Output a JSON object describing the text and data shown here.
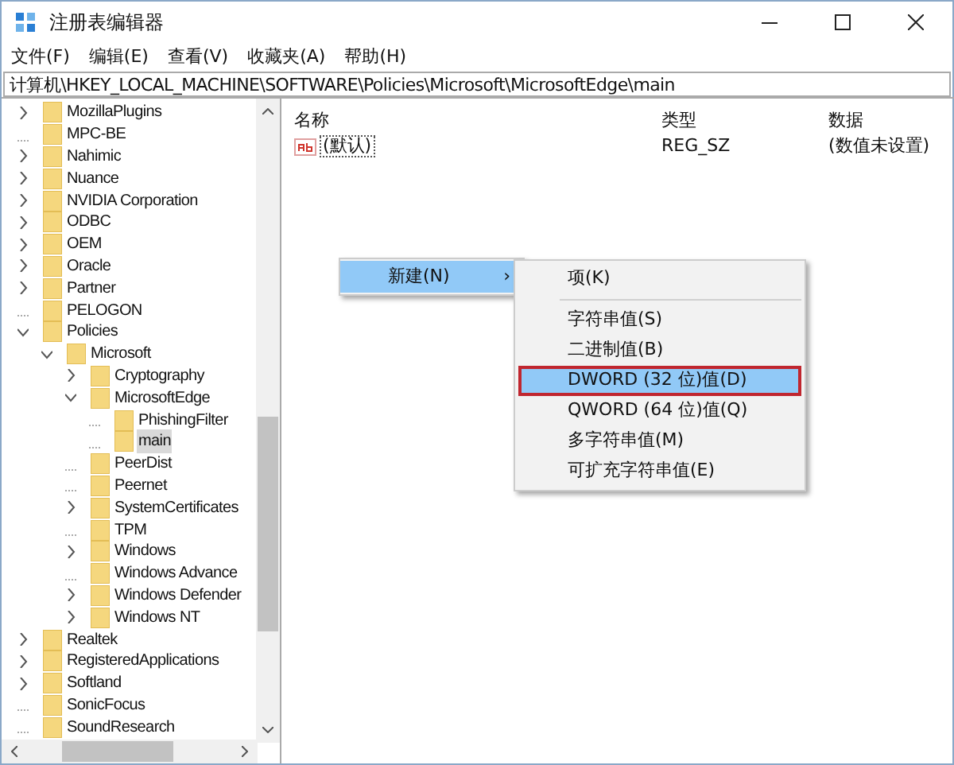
{
  "window": {
    "title": "注册表编辑器"
  },
  "menu_bar": [
    "文件(F)",
    "编辑(E)",
    "查看(V)",
    "收藏夹(A)",
    "帮助(H)"
  ],
  "address_bar": "计算机\\HKEY_LOCAL_MACHINE\\SOFTWARE\\Policies\\Microsoft\\MicrosoftEdge\\main",
  "tree": [
    {
      "label": "MozillaPlugins",
      "expanded": false,
      "selected": false
    },
    {
      "label": "MPC-BE",
      "selected": false
    },
    {
      "label": "Nahimic",
      "expanded": false,
      "selected": false
    },
    {
      "label": "Nuance",
      "expanded": false,
      "selected": false
    },
    {
      "label": "NVIDIA Corporation",
      "expanded": false,
      "selected": false
    },
    {
      "label": "ODBC",
      "expanded": false,
      "selected": false
    },
    {
      "label": "OEM",
      "expanded": false,
      "selected": false
    },
    {
      "label": "Oracle",
      "expanded": false,
      "selected": false
    },
    {
      "label": "Partner",
      "expanded": false,
      "selected": false
    },
    {
      "label": "PELOGON",
      "selected": false
    },
    {
      "label": "Policies",
      "expanded": true,
      "selected": false,
      "children": [
        {
          "label": "Microsoft",
          "expanded": true,
          "selected": false,
          "children": [
            {
              "label": "Cryptography",
              "expanded": false,
              "selected": false
            },
            {
              "label": "MicrosoftEdge",
              "expanded": true,
              "selected": false,
              "children": [
                {
                  "label": "PhishingFilter",
                  "selected": false
                },
                {
                  "label": "main",
                  "selected": true
                }
              ]
            },
            {
              "label": "PeerDist",
              "selected": false
            },
            {
              "label": "Peernet",
              "selected": false
            },
            {
              "label": "SystemCertificates",
              "expanded": false,
              "selected": false
            },
            {
              "label": "TPM",
              "selected": false
            },
            {
              "label": "Windows",
              "expanded": false,
              "selected": false
            },
            {
              "label": "Windows Advance",
              "selected": false
            },
            {
              "label": "Windows Defender",
              "expanded": false,
              "selected": false
            },
            {
              "label": "Windows NT",
              "expanded": false,
              "selected": false
            }
          ]
        }
      ]
    },
    {
      "label": "Realtek",
      "expanded": false,
      "selected": false
    },
    {
      "label": "RegisteredApplications",
      "expanded": false,
      "selected": false
    },
    {
      "label": "Softland",
      "expanded": false,
      "selected": false
    },
    {
      "label": "SonicFocus",
      "selected": false
    },
    {
      "label": "SoundResearch",
      "selected": false
    }
  ],
  "list": {
    "columns": [
      "名称",
      "类型",
      "数据"
    ],
    "rows": [
      {
        "name": "(默认)",
        "type": "REG_SZ",
        "data": "(数值未设置)"
      }
    ]
  },
  "context_menu": {
    "items": [
      {
        "label": "新建(N)",
        "submenu_arrow": "›",
        "selected": true
      }
    ]
  },
  "submenu": {
    "items": [
      {
        "kind": "item",
        "label": "项(K)",
        "selected": false,
        "outlined": false
      },
      {
        "kind": "separator"
      },
      {
        "kind": "item",
        "label": "字符串值(S)",
        "selected": false,
        "outlined": false
      },
      {
        "kind": "item",
        "label": "二进制值(B)",
        "selected": false,
        "outlined": false
      },
      {
        "kind": "item",
        "label": "DWORD (32 位)值(D)",
        "selected": true,
        "outlined": true
      },
      {
        "kind": "item",
        "label": "QWORD (64 位)值(Q)",
        "selected": false,
        "outlined": false
      },
      {
        "kind": "item",
        "label": "多字符串值(M)",
        "selected": false,
        "outlined": false
      },
      {
        "kind": "item",
        "label": "可扩充字符串值(E)",
        "selected": false,
        "outlined": false
      }
    ]
  }
}
